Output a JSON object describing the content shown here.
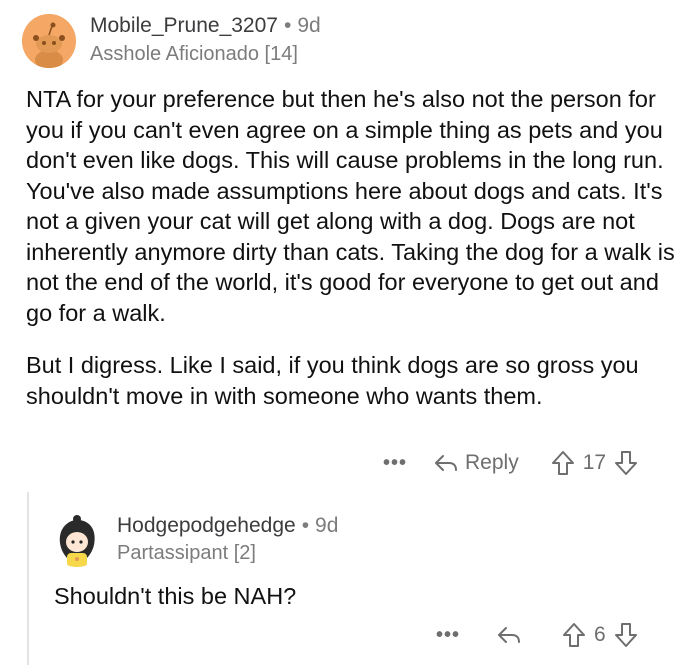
{
  "comment": {
    "username": "Mobile_Prune_3207",
    "age": "9d",
    "flair": "Asshole Aficionado [14]",
    "paragraphs": [
      "NTA for your preference but then he's also not the person for you if you can't even agree on a simple thing as pets and you don't even like dogs. This will cause problems in the long run. You've also made assumptions here about dogs and cats. It's not a given your cat will get along with a dog. Dogs are not inherently anymore dirty than cats. Taking the dog for a walk is not the end of the world, it's good for everyone to get out and go for a walk.",
      "But I digress. Like I said, if you think dogs are so gross you shouldn't move in with someone who wants them."
    ],
    "more_label": "•••",
    "reply_label": "Reply",
    "vote_count": "17"
  },
  "reply": {
    "username": "Hodgepodgehedge",
    "age": "9d",
    "flair": "Partassipant [2]",
    "text": "Shouldn't this be NAH?",
    "more_label": "•••",
    "vote_count": "6"
  },
  "separator": "•"
}
